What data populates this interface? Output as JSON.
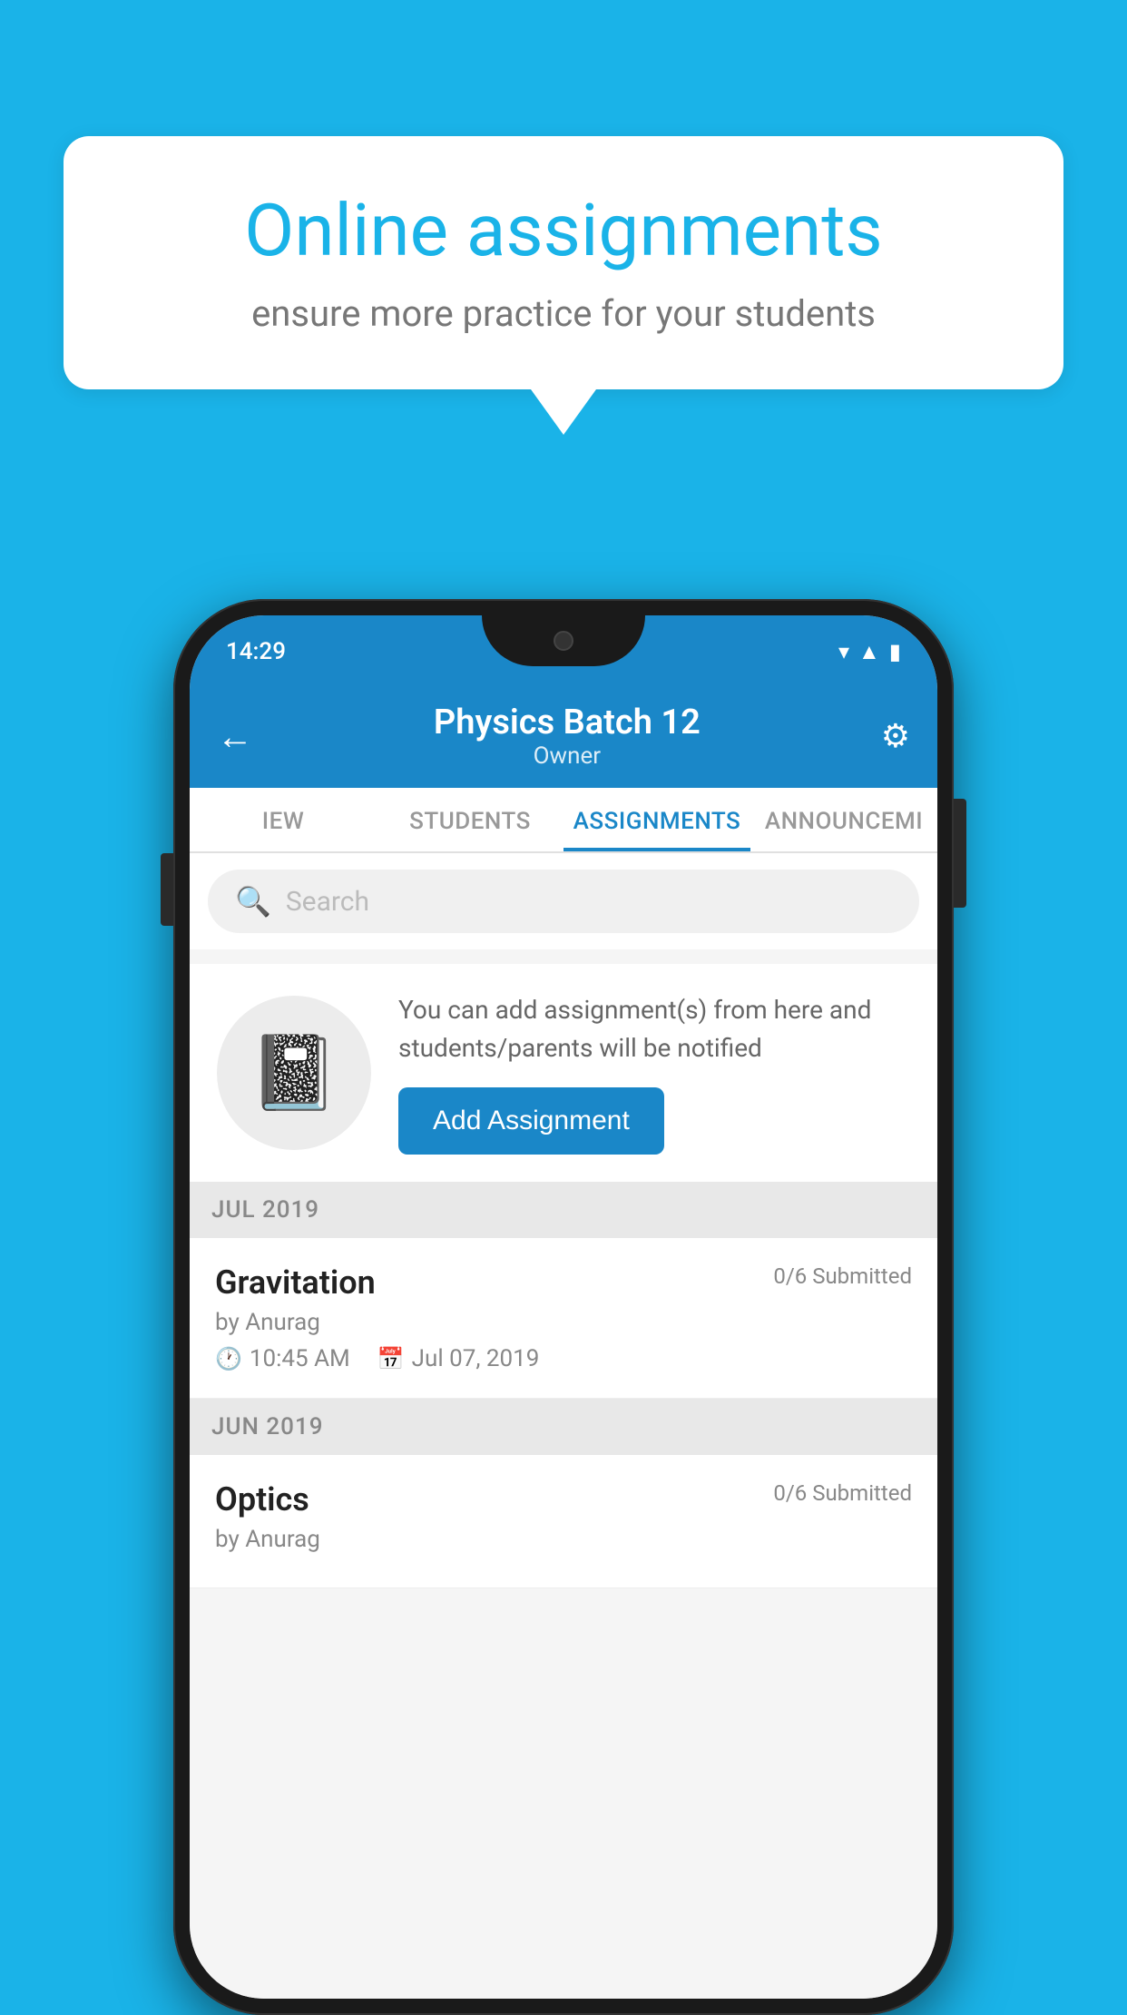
{
  "background_color": "#1ab3e8",
  "speech_bubble": {
    "title": "Online assignments",
    "subtitle": "ensure more practice for your students"
  },
  "phone": {
    "status_bar": {
      "time": "14:29",
      "icons": [
        "wifi",
        "signal",
        "battery"
      ]
    },
    "header": {
      "back_label": "←",
      "title": "Physics Batch 12",
      "subtitle": "Owner",
      "settings_label": "⚙"
    },
    "tabs": [
      {
        "label": "IEW",
        "active": false
      },
      {
        "label": "STUDENTS",
        "active": false
      },
      {
        "label": "ASSIGNMENTS",
        "active": true
      },
      {
        "label": "ANNOUNCEM...",
        "active": false
      }
    ],
    "search": {
      "placeholder": "Search"
    },
    "promo": {
      "description": "You can add assignment(s) from here and students/parents will be notified",
      "button_label": "Add Assignment"
    },
    "assignment_sections": [
      {
        "month_label": "JUL 2019",
        "assignments": [
          {
            "title": "Gravitation",
            "submitted": "0/6 Submitted",
            "author": "by Anurag",
            "time": "10:45 AM",
            "date": "Jul 07, 2019"
          }
        ]
      },
      {
        "month_label": "JUN 2019",
        "assignments": [
          {
            "title": "Optics",
            "submitted": "0/6 Submitted",
            "author": "by Anurag",
            "time": "",
            "date": ""
          }
        ]
      }
    ]
  }
}
